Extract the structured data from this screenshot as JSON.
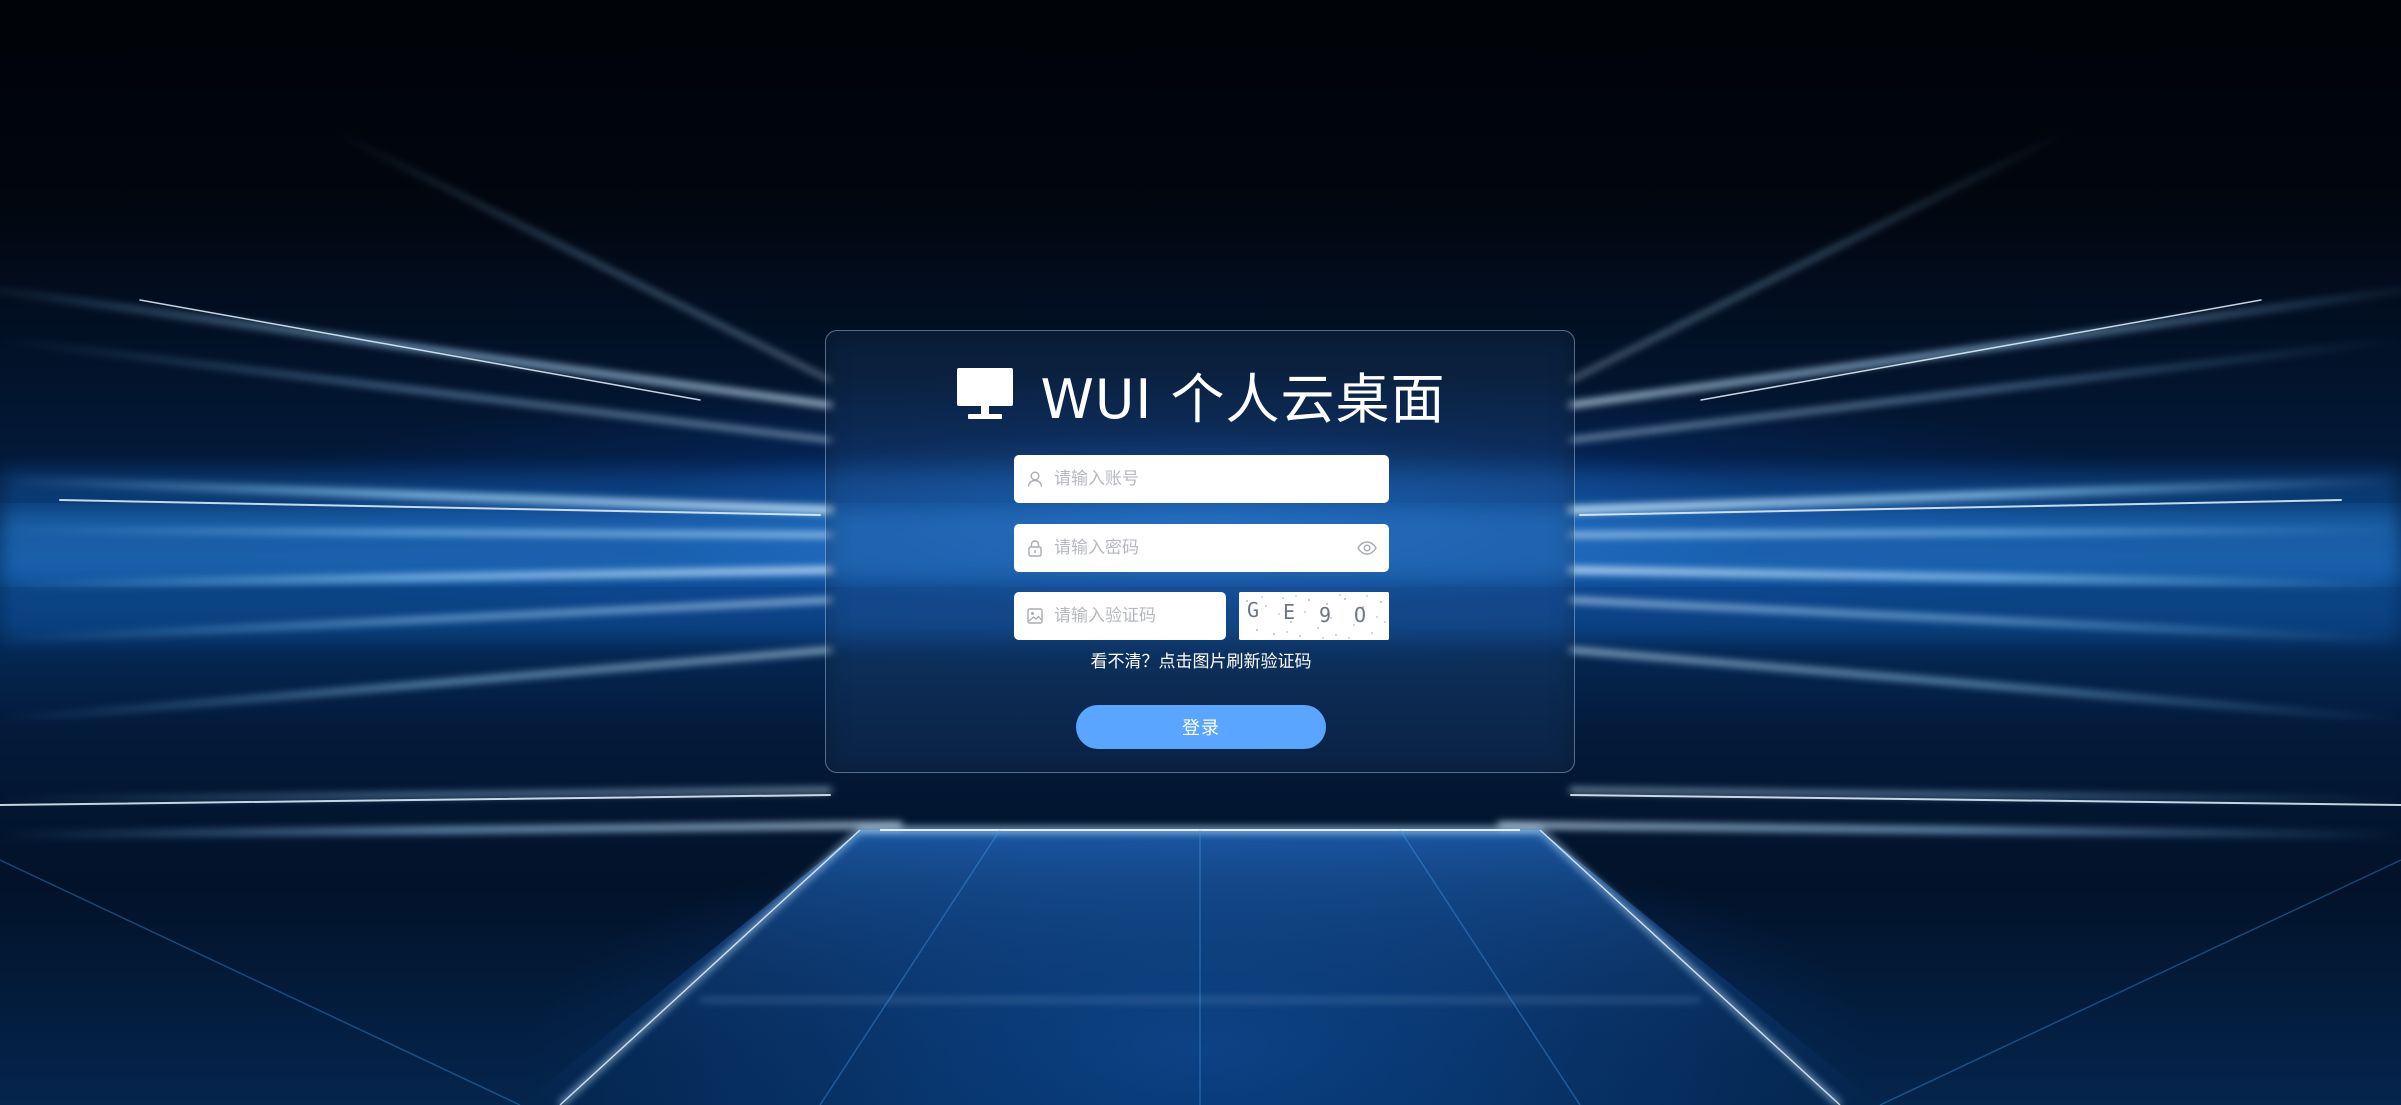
{
  "app": {
    "title": "WUI 个人云桌面",
    "logo_icon": "monitor-icon"
  },
  "form": {
    "account": {
      "value": "",
      "placeholder": "请输入账号",
      "icon": "user-icon"
    },
    "password": {
      "value": "",
      "placeholder": "请输入密码",
      "icon": "lock-icon",
      "toggle_icon": "eye-icon"
    },
    "captcha": {
      "value": "",
      "placeholder": "请输入验证码",
      "icon": "picture-icon"
    },
    "captcha_image": {
      "code": "GE9O",
      "chars": [
        "G",
        "E",
        "9",
        "O"
      ]
    },
    "refresh_hint": "看不清？点击图片刷新验证码",
    "login_label": "登录"
  },
  "colors": {
    "accent": "#5aa5ff",
    "title": "#ffffff",
    "placeholder": "#b6b9c0",
    "panel_border": "#b4cdeb"
  }
}
